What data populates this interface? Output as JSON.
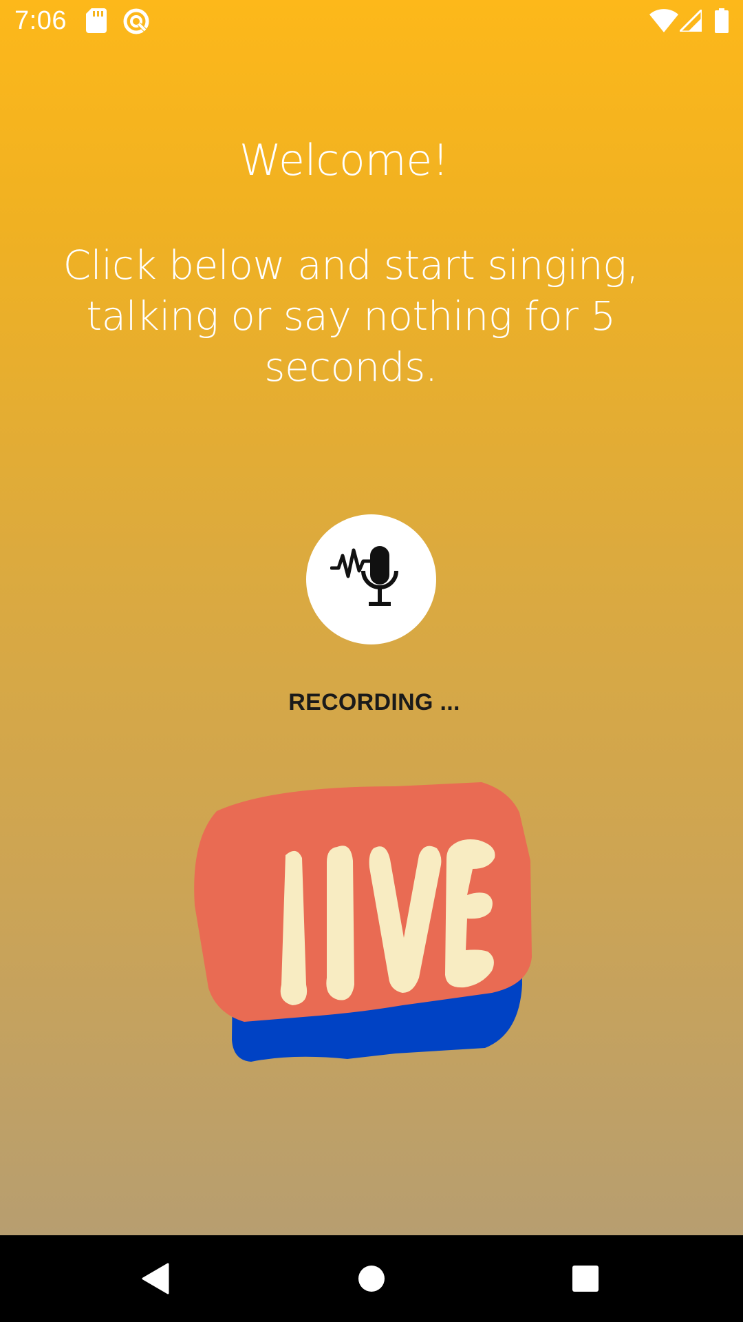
{
  "status_bar": {
    "time": "7:06",
    "left_icons": [
      "sd-card-icon",
      "sync-icon"
    ],
    "right_icons": [
      "wifi-icon",
      "cell-signal-icon",
      "battery-icon"
    ]
  },
  "main": {
    "welcome_title": "Welcome!",
    "instruction_lines": [
      "Click below and start singing,",
      "talking or say nothing for 5",
      "seconds."
    ],
    "mic_button_icon": "voice-record-icon",
    "status_text": "RECORDING ...",
    "sticker_text": "LIVE"
  },
  "nav_bar": {
    "buttons": [
      "back-icon",
      "home-icon",
      "recents-icon"
    ]
  },
  "colors": {
    "gradient_top": "#fdb81a",
    "gradient_bottom": "#b79e70",
    "sticker_red": "#e96b53",
    "sticker_blue": "#0042c4",
    "sticker_letters": "#f8ecc2"
  }
}
